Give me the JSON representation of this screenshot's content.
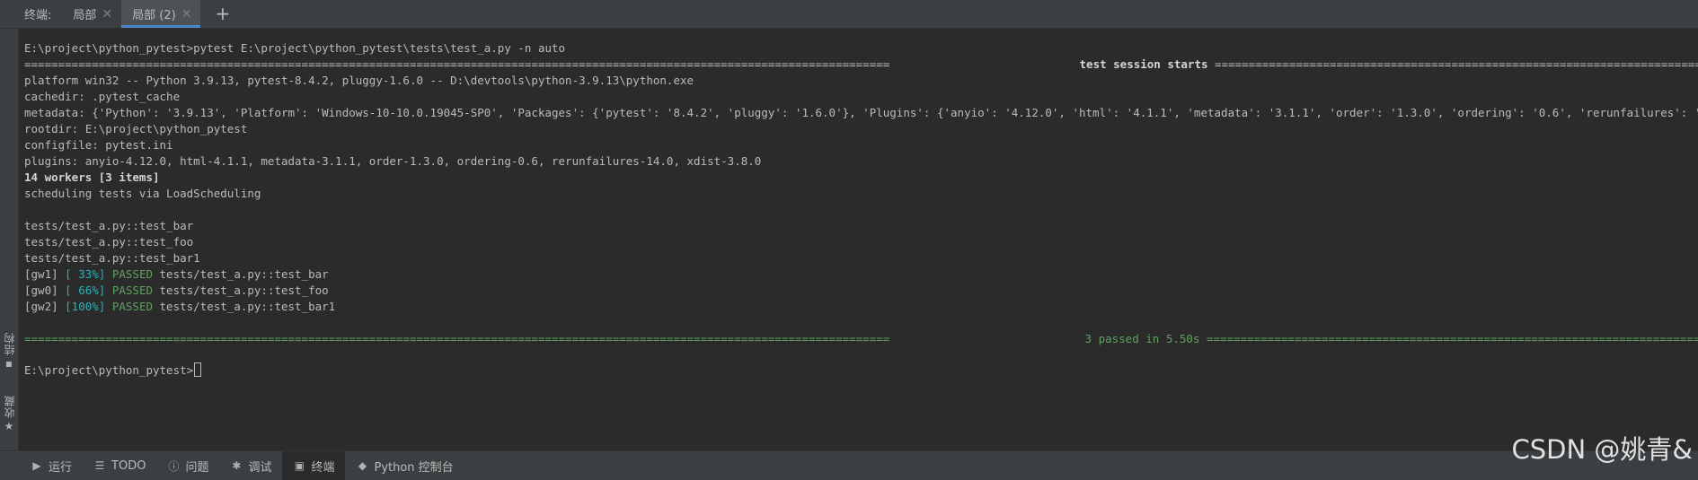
{
  "tabbar": {
    "title": "终端:",
    "tabs": [
      {
        "label": "局部",
        "close": "✕"
      },
      {
        "label": "局部 (2)",
        "close": "✕"
      }
    ],
    "add": "+"
  },
  "sidestrip": {
    "structure_label": "结构",
    "favorites_label": "收藏"
  },
  "terminal": {
    "command_line": "E:\\project\\python_pytest>pytest E:\\project\\python_pytest\\tests\\test_a.py -n auto",
    "session_header_left": "================================================================================================================================",
    "session_header_title": " test session starts ",
    "session_header_right": "================================================================================================================================",
    "platform": "platform win32 -- Python 3.9.13, pytest-8.4.2, pluggy-1.6.0 -- D:\\devtools\\python-3.9.13\\python.exe",
    "cachedir": "cachedir: .pytest_cache",
    "metadata": "metadata: {'Python': '3.9.13', 'Platform': 'Windows-10-10.0.19045-SP0', 'Packages': {'pytest': '8.4.2', 'pluggy': '1.6.0'}, 'Plugins': {'anyio': '4.12.0', 'html': '4.1.1', 'metadata': '3.1.1', 'order': '1.3.0', 'ordering': '0.6', 'rerunfailures': '1",
    "rootdir": "rootdir: E:\\project\\python_pytest",
    "configfile": "configfile: pytest.ini",
    "plugins": "plugins: anyio-4.12.0, html-4.1.1, metadata-3.1.1, order-1.3.0, ordering-0.6, rerunfailures-14.0, xdist-3.8.0",
    "workers": "14 workers [3 items]",
    "scheduling": "scheduling tests via LoadScheduling",
    "collected": [
      "tests/test_a.py::test_bar",
      "tests/test_a.py::test_foo",
      "tests/test_a.py::test_bar1"
    ],
    "results": [
      {
        "worker": "[gw1] ",
        "progress": "[ 33%]",
        "status": " PASSED ",
        "test": "tests/test_a.py::test_bar"
      },
      {
        "worker": "[gw0] ",
        "progress": "[ 66%]",
        "status": " PASSED ",
        "test": "tests/test_a.py::test_foo"
      },
      {
        "worker": "[gw2] ",
        "progress": "[100%]",
        "status": " PASSED ",
        "test": "tests/test_a.py::test_bar1"
      }
    ],
    "summary_left": "================================================================================================================================",
    "summary_title": " 3 passed in 5.50s ",
    "summary_right": "================================================================================================================================",
    "prompt": "E:\\project\\python_pytest>"
  },
  "bottombar": {
    "items": [
      {
        "label": "运行",
        "icon": "play-icon"
      },
      {
        "label": "TODO",
        "icon": "todo-list-icon"
      },
      {
        "label": "问题",
        "icon": "problems-icon"
      },
      {
        "label": "调试",
        "icon": "bug-icon"
      },
      {
        "label": "终端",
        "icon": "terminal-icon"
      },
      {
        "label": "Python 控制台",
        "icon": "python-icon"
      }
    ]
  },
  "watermark": "CSDN @姚青&",
  "colors": {
    "background": "#2b2b2b",
    "panel": "#3c3f41",
    "passed": "#5fa05f",
    "progress": "#2ab3b8",
    "accent": "#4a88c7"
  }
}
